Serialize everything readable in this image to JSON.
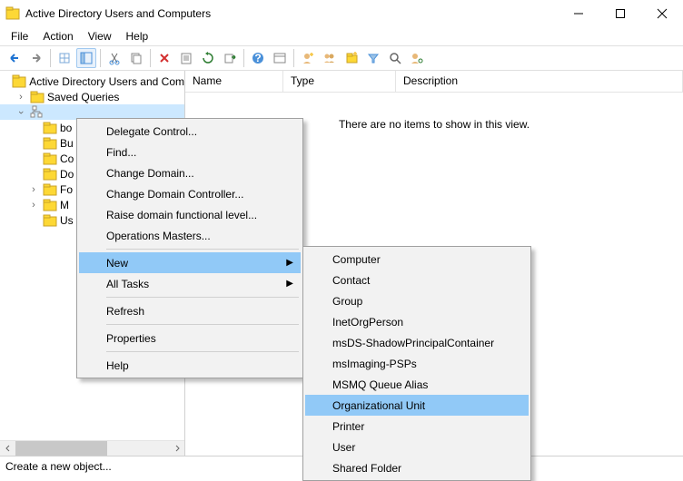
{
  "window": {
    "title": "Active Directory Users and Computers"
  },
  "menu": {
    "file": "File",
    "action": "Action",
    "view": "View",
    "help": "Help"
  },
  "tree": {
    "root": "Active Directory Users and Com",
    "saved_queries": "Saved Queries",
    "domain": "",
    "children": [
      "bo",
      "Bu",
      "Co",
      "Do",
      "Fo",
      "M",
      "Us"
    ]
  },
  "columns": {
    "name": "Name",
    "type": "Type",
    "desc": "Description"
  },
  "empty_msg": "There are no items to show in this view.",
  "ctx1": {
    "delegate": "Delegate Control...",
    "find": "Find...",
    "change_domain": "Change Domain...",
    "change_dc": "Change Domain Controller...",
    "raise": "Raise domain functional level...",
    "ops": "Operations Masters...",
    "new": "New",
    "all_tasks": "All Tasks",
    "refresh": "Refresh",
    "properties": "Properties",
    "help": "Help"
  },
  "ctx2": {
    "computer": "Computer",
    "contact": "Contact",
    "group": "Group",
    "inetorg": "InetOrgPerson",
    "msds": "msDS-ShadowPrincipalContainer",
    "msimg": "msImaging-PSPs",
    "msmq": "MSMQ Queue Alias",
    "ou": "Organizational Unit",
    "printer": "Printer",
    "user": "User",
    "shared": "Shared Folder"
  },
  "status": "Create a new object..."
}
